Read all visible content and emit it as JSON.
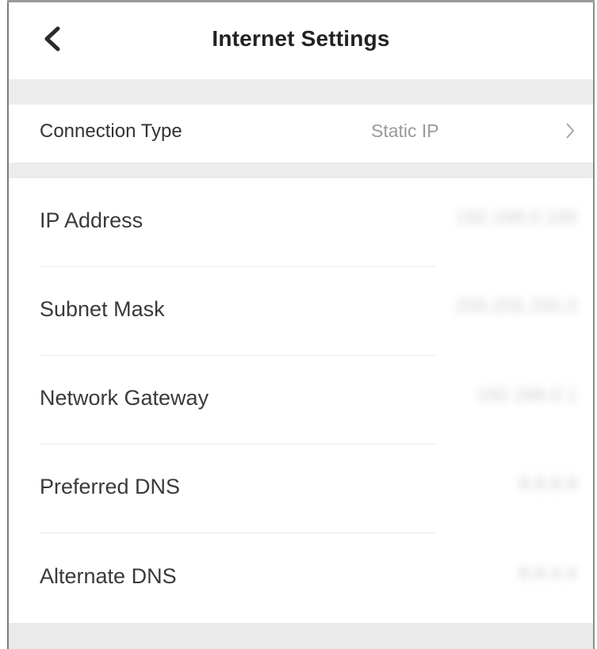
{
  "header": {
    "title": "Internet Settings",
    "back_icon": "chevron-left-icon"
  },
  "connection": {
    "label": "Connection Type",
    "value": "Static IP",
    "chevron_icon": "chevron-right-icon"
  },
  "fields": [
    {
      "label": "IP Address",
      "value": "192.168.0.100"
    },
    {
      "label": "Subnet Mask",
      "value": "255.255.255.0"
    },
    {
      "label": "Network Gateway",
      "value": "192.168.0.1"
    },
    {
      "label": "Preferred DNS",
      "value": "8.8.8.8"
    },
    {
      "label": "Alternate DNS",
      "value": "8.8.4.4"
    }
  ],
  "colors": {
    "background": "#ffffff",
    "section_gap": "#ececec",
    "title_text": "#222222",
    "label_text": "#3a3a3a",
    "secondary_text": "#9a9a9a"
  }
}
